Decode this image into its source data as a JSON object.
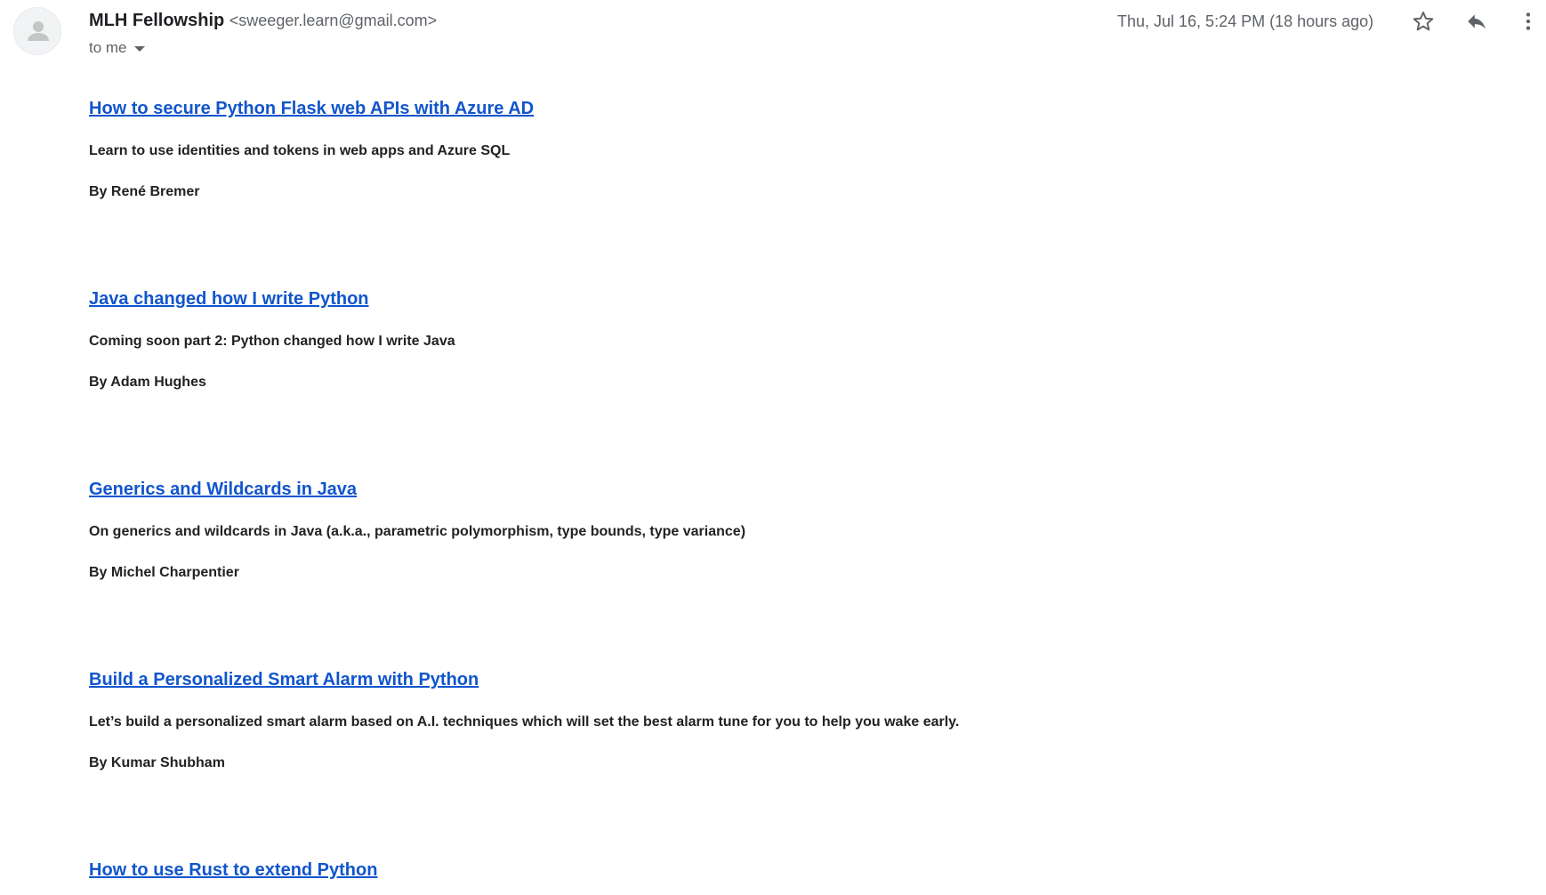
{
  "sender": {
    "name": "MLH Fellowship",
    "email": "<sweeger.learn@gmail.com>"
  },
  "recipient": "to me",
  "timestamp": "Thu, Jul 16, 5:24 PM (18 hours ago)",
  "icons": {
    "avatar": "default-avatar-icon",
    "star": "star-outline-icon",
    "reply": "reply-icon",
    "more": "more-vert-icon",
    "expand": "caret-down-icon"
  },
  "colors": {
    "link": "#1155cc",
    "body_text": "#222222",
    "muted": "#5f6368"
  },
  "articles": [
    {
      "title": "How to secure Python Flask web APIs with Azure AD",
      "description": "Learn to use identities and tokens in web apps and Azure SQL",
      "author": "By René Bremer"
    },
    {
      "title": "Java changed how I write Python",
      "description": "Coming soon part 2: Python changed how I write Java",
      "author": "By Adam Hughes"
    },
    {
      "title": "Generics and Wildcards in Java",
      "description": "On generics and wildcards in Java (a.k.a., parametric polymorphism, type bounds, type variance)",
      "author": "By Michel Charpentier"
    },
    {
      "title": "Build a Personalized Smart Alarm with Python",
      "description": "Let’s build a personalized smart alarm based on A.I. techniques which will set the best alarm tune for you to help you wake early.",
      "author": "By Kumar Shubham"
    },
    {
      "title": "How to use Rust to extend Python",
      "description": "",
      "author": ""
    }
  ]
}
